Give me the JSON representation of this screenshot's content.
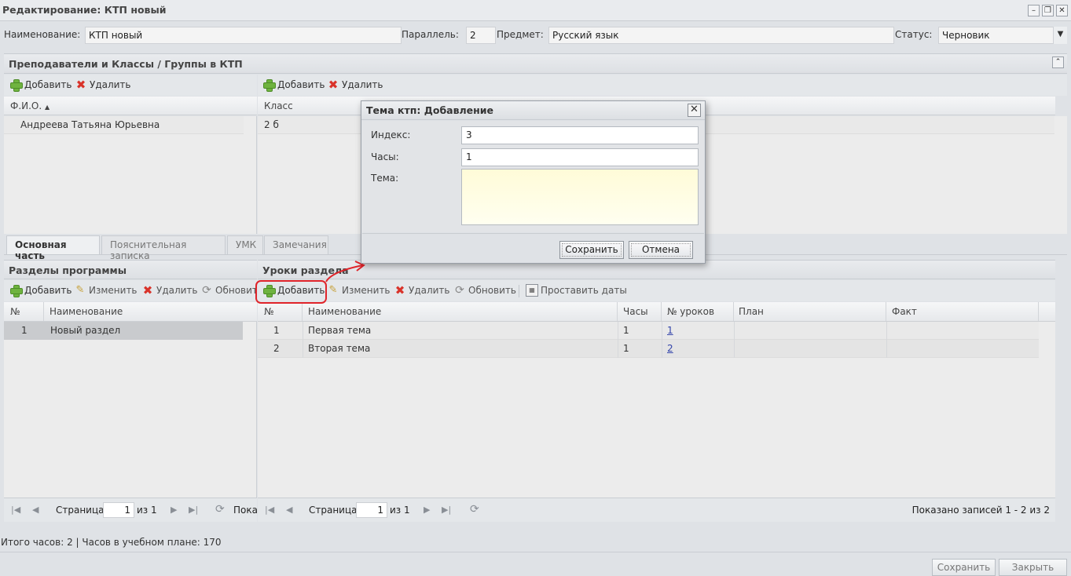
{
  "window": {
    "title": "Редактирование: КТП новый"
  },
  "form": {
    "name_label": "Наименование:",
    "name_value": "КТП новый",
    "parallel_label": "Параллель:",
    "parallel_value": "2",
    "subject_label": "Предмет:",
    "subject_value": "Русский язык",
    "status_label": "Статус:",
    "status_value": "Черновик"
  },
  "teachers_panel": {
    "title": "Преподаватели и Классы / Группы в КТП",
    "left_toolbar": {
      "add": "Добавить",
      "delete": "Удалить"
    },
    "right_toolbar": {
      "add": "Добавить",
      "delete": "Удалить"
    },
    "fio_header": "Ф.И.О.",
    "class_header": "Класс",
    "teachers": [
      {
        "fio": "Андреева Татьяна Юрьевна"
      }
    ],
    "classes": [
      {
        "name": "2 б"
      }
    ]
  },
  "tabs": [
    {
      "label": "Основная часть",
      "active": true
    },
    {
      "label": "Пояснительная записка",
      "active": false
    },
    {
      "label": "УМК",
      "active": false
    },
    {
      "label": "Замечания",
      "active": false
    }
  ],
  "sections": {
    "title": "Разделы программы",
    "toolbar": {
      "add": "Добавить",
      "edit": "Изменить",
      "delete": "Удалить",
      "refresh": "Обновить"
    },
    "columns": {
      "num": "№",
      "name": "Наименование"
    },
    "rows": [
      {
        "num": "1",
        "name": "Новый раздел"
      }
    ],
    "pager": {
      "page_label": "Страница",
      "page": "1",
      "of": "из 1",
      "shown": "Пока"
    }
  },
  "lessons": {
    "title": "Уроки раздела",
    "toolbar": {
      "add": "Добавить",
      "edit": "Изменить",
      "delete": "Удалить",
      "refresh": "Обновить",
      "dates": "Проставить даты"
    },
    "columns": {
      "num": "№",
      "name": "Наименование",
      "hours": "Часы",
      "lessons": "№ уроков",
      "plan": "План",
      "fact": "Факт"
    },
    "rows": [
      {
        "num": "1",
        "name": "Первая тема",
        "hours": "1",
        "lessons": "1",
        "plan": "",
        "fact": ""
      },
      {
        "num": "2",
        "name": "Вторая тема",
        "hours": "1",
        "lessons": "2",
        "plan": "",
        "fact": ""
      }
    ],
    "pager": {
      "page_label": "Страница",
      "page": "1",
      "of": "из 1",
      "shown": "Показано записей 1 - 2 из 2"
    }
  },
  "status_bar": {
    "text": "Итого часов: 2 | Часов в учебном плане: 170"
  },
  "bottom_buttons": {
    "save": "Сохранить",
    "close": "Закрыть"
  },
  "dialog": {
    "title": "Тема ктп: Добавление",
    "index_label": "Индекс:",
    "index_value": "3",
    "hours_label": "Часы:",
    "hours_value": "1",
    "topic_label": "Тема:",
    "topic_value": "",
    "save": "Сохранить",
    "cancel": "Отмена"
  },
  "colors": {
    "highlight": "#e0242a",
    "add_icon": "#6fb33f",
    "delete_icon": "#d9332a"
  }
}
